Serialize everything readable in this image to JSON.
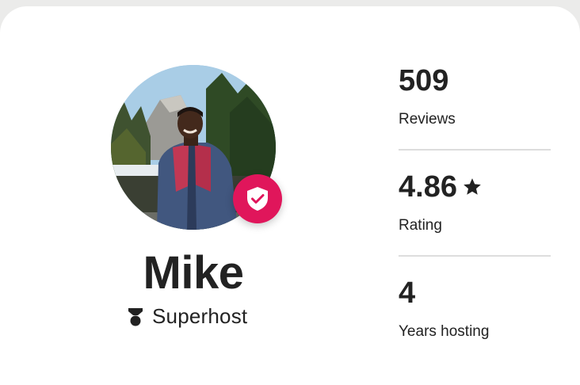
{
  "host": {
    "name": "Mike",
    "role": "Superhost"
  },
  "stats": [
    {
      "value": "509",
      "label": "Reviews"
    },
    {
      "value": "4.86",
      "label": "Rating",
      "icon": "star-icon"
    },
    {
      "value": "4",
      "label": "Years hosting"
    }
  ],
  "colors": {
    "badge": "#e0165b",
    "text": "#222222",
    "divider": "#dddddd"
  },
  "icons": {
    "verified": "shield-check-icon",
    "superhost": "superhost-medal-icon",
    "rating": "star-icon"
  }
}
